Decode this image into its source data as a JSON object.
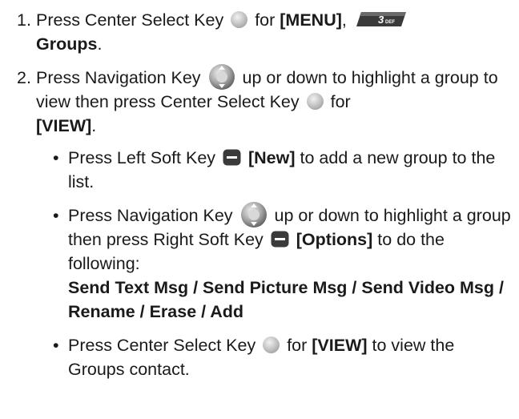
{
  "steps": [
    {
      "number": "1.",
      "t1": "Press Center Select Key",
      "t2": "for",
      "b1": "[MENU]",
      "t3": ",",
      "key3_label": "3",
      "key3_sub": "DEF",
      "b2": "Groups",
      "t4": "."
    },
    {
      "number": "2.",
      "t1": "Press Navigation Key",
      "t2": "up or down to highlight a group to view then press Center Select Key",
      "t3": "for",
      "b1": "[VIEW]",
      "t4": "."
    }
  ],
  "bullets": [
    {
      "t1": "Press Left Soft Key",
      "b1": "[New]",
      "t2": "to add a new group to the list."
    },
    {
      "t1": "Press Navigation Key",
      "t2": "up or down to highlight a group then press Right Soft Key",
      "b1": "[Options]",
      "t3": "to do the following:",
      "b2": "Send Text Msg / Send Picture Msg / Send Video Msg / Rename / Erase / Add"
    },
    {
      "t1": "Press Center Select Key",
      "t2": "for",
      "b1": "[VIEW]",
      "t3": "to view the Groups contact."
    }
  ],
  "bullet_char": "•",
  "colors": {
    "text": "#1a1a1a",
    "key_dark": "#3a3a3a",
    "key_light": "#bcbcbc"
  },
  "icons": [
    "center-select-key-icon",
    "navigation-key-icon",
    "left-soft-key-icon",
    "right-soft-key-icon",
    "key-3-def-icon"
  ]
}
